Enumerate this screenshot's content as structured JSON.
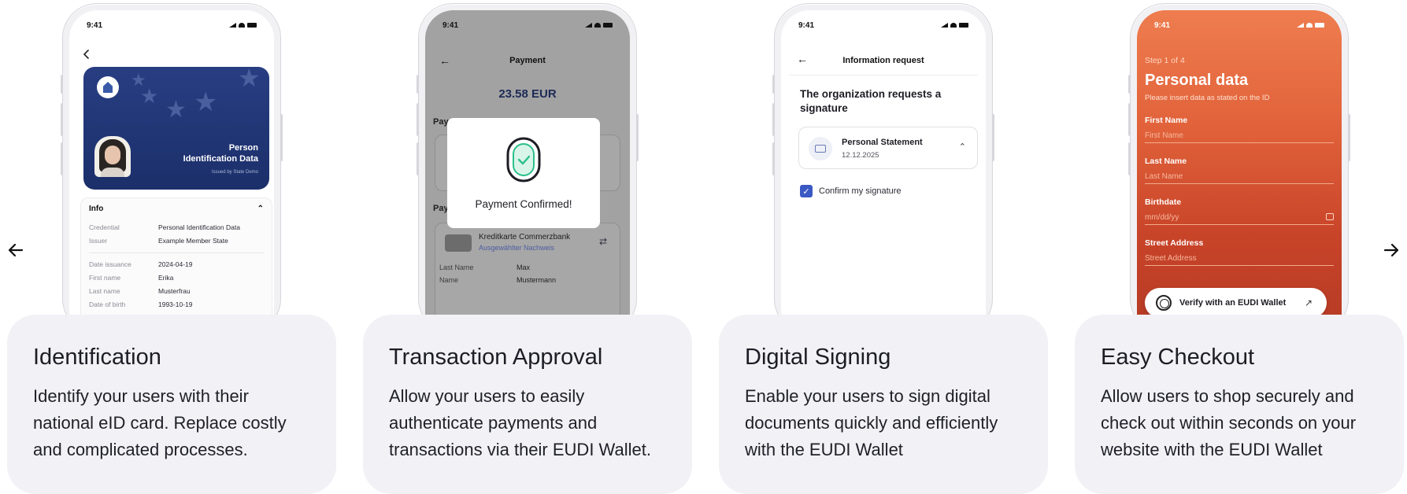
{
  "slides": [
    {
      "card": {
        "title": "Identification",
        "description": "Identify your users with their national eID card. Replace costly and complicated processes."
      },
      "phone": {
        "time": "9:41",
        "id_card": {
          "title_line1": "Person",
          "title_line2": "Identification Data",
          "issued": "Issued by State Demo"
        },
        "info": {
          "heading": "Info",
          "rows_top": [
            {
              "key": "Credential",
              "value": "Personal Identification Data"
            },
            {
              "key": "Issuer",
              "value": "Example Member State"
            }
          ],
          "rows_bottom": [
            {
              "key": "Date issuance",
              "value": "2024-04-19"
            },
            {
              "key": "First name",
              "value": "Erika"
            },
            {
              "key": "Last name",
              "value": "Musterfrau"
            },
            {
              "key": "Date of birth",
              "value": "1993-10-19"
            }
          ]
        }
      }
    },
    {
      "card": {
        "title": "Transaction Approval",
        "description": "Allow your users to easily authenticate payments and transactions via their EUDI Wallet."
      },
      "phone": {
        "time": "9:41",
        "header_title": "Payment",
        "amount": "23.58 EUR",
        "label_pay": "Pay",
        "label_method": "Payment method",
        "card_name": "Kreditkarte Commerzbank",
        "card_sub": "Ausgewählter Nachweis",
        "rows": [
          {
            "key": "Last Name",
            "value": "Max"
          },
          {
            "key": "Name",
            "value": "Mustermann"
          }
        ],
        "modal_text": "Payment Confirmed!"
      }
    },
    {
      "card": {
        "title": "Digital Signing",
        "description": "Enable your users to sign digital documents quickly and efficiently with the EUDI Wallet"
      },
      "phone": {
        "time": "9:41",
        "header_title": "Information request",
        "heading": "The organization requests a signature",
        "document_name": "Personal Statement",
        "document_date": "12.12.2025",
        "checkbox_label": "Confirm my signature"
      }
    },
    {
      "card": {
        "title": "Easy Checkout",
        "description": "Allow users to shop securely and check out within seconds on your website with the EUDI Wallet"
      },
      "phone": {
        "time": "9:41",
        "step": "Step 1 of 4",
        "title": "Personal data",
        "subtitle": "Please insert data as stated on the ID",
        "fields": [
          {
            "label": "First Name",
            "placeholder": "First Name"
          },
          {
            "label": "Last Name",
            "placeholder": "Last Name"
          },
          {
            "label": "Birthdate",
            "placeholder": "mm/dd/yy"
          },
          {
            "label": "Street Address",
            "placeholder": "Street Address"
          }
        ],
        "verify_button": "Verify with an EUDI Wallet"
      }
    }
  ],
  "icons": {
    "prev": "arrow-left-icon",
    "next": "arrow-right-icon"
  },
  "colors": {
    "card_bg": "#f1f1f6",
    "id_card_blue": "#1b2f6a",
    "checkout_orange": "#e2633b",
    "confirm_green": "#2bbf8c",
    "checkbox_blue": "#3b59c4"
  }
}
